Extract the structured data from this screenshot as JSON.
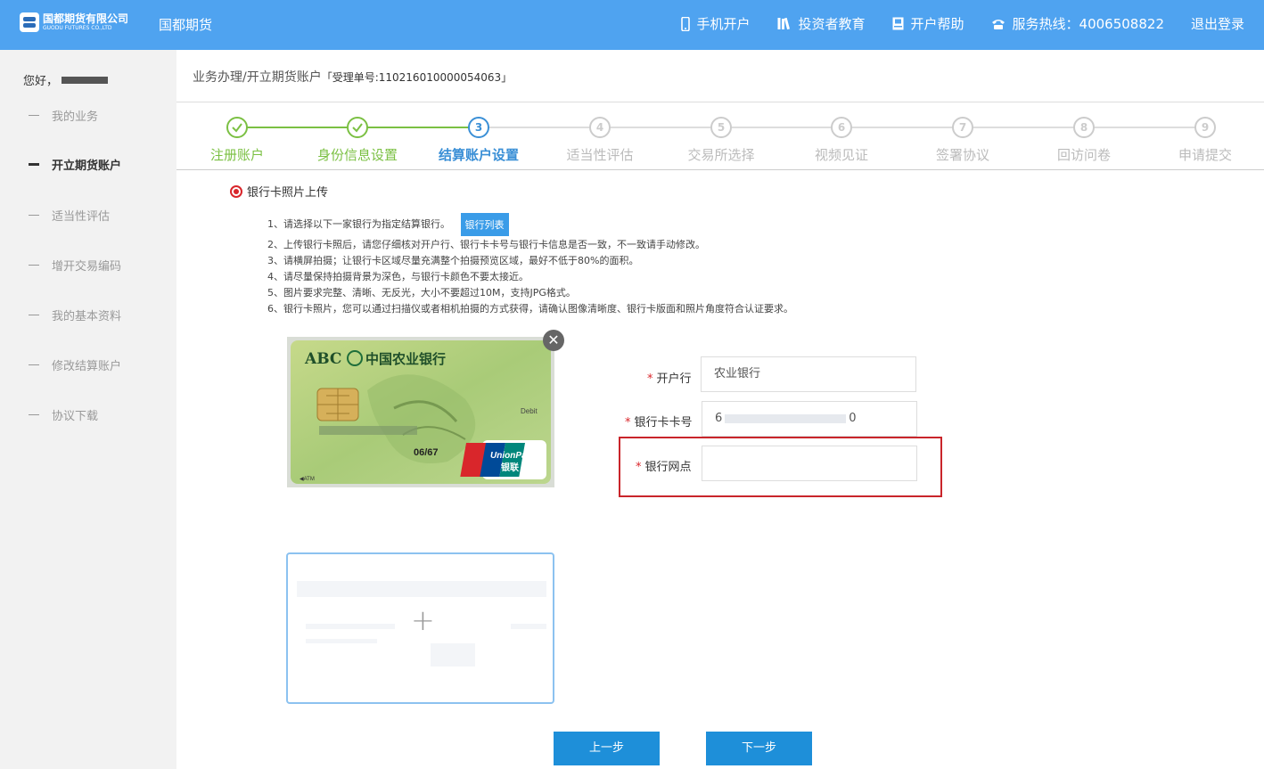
{
  "header": {
    "logo_cn": "国都期货有限公司",
    "logo_en": "GUODU FUTURES CO.,LTD",
    "brand": "国都期货",
    "nav": {
      "mobile_label": "手机开户",
      "edu_label": "投资者教育",
      "help_label": "开户帮助",
      "hotline_label": "服务热线：4006508822",
      "logout_label": "退出登录"
    }
  },
  "sidebar": {
    "greeting": "您好，",
    "items": [
      {
        "label": "我的业务"
      },
      {
        "label": "开立期货账户"
      },
      {
        "label": "适当性评估"
      },
      {
        "label": "增开交易编码"
      },
      {
        "label": "我的基本资料"
      },
      {
        "label": "修改结算账户"
      },
      {
        "label": "协议下载"
      }
    ]
  },
  "breadcrumb": {
    "path": "业务办理/开立期货账户",
    "ticket": "「受理单号:110216010000054063」"
  },
  "steps": [
    {
      "num": "1",
      "label": "注册账户",
      "status": "done"
    },
    {
      "num": "2",
      "label": "身份信息设置",
      "status": "done"
    },
    {
      "num": "3",
      "label": "结算账户设置",
      "status": "current"
    },
    {
      "num": "4",
      "label": "适当性评估",
      "status": "pending"
    },
    {
      "num": "5",
      "label": "交易所选择",
      "status": "pending"
    },
    {
      "num": "6",
      "label": "视频见证",
      "status": "pending"
    },
    {
      "num": "7",
      "label": "签署协议",
      "status": "pending"
    },
    {
      "num": "8",
      "label": "回访问卷",
      "status": "pending"
    },
    {
      "num": "9",
      "label": "申请提交",
      "status": "pending"
    }
  ],
  "upload_section": {
    "title": "银行卡照片上传",
    "instructions": [
      "1、请选择以下一家银行为指定结算银行。",
      "2、上传银行卡照后，请您仔细核对开户行、银行卡卡号与银行卡信息是否一致，不一致请手动修改。",
      "3、请横屏拍摄；让银行卡区域尽量充满整个拍摄预览区域，最好不低于80%的面积。",
      "4、请尽量保持拍摄背景为深色，与银行卡颜色不要太接近。",
      "5、图片要求完整、清晰、无反光，大小不要超过10M，支持JPG格式。",
      "6、银行卡照片，您可以通过扫描仪或者相机拍摄的方式获得，请确认图像清晰度、银行卡版面和照片角度符合认证要求。"
    ],
    "bank_list_button": "银行列表",
    "card": {
      "abc": "ABC",
      "bank_name": "中国农业银行",
      "debit": "Debit",
      "expiry": "06/67",
      "unionpay": "UnionPay",
      "unionpay_cn": "银联",
      "atm": "◀ATM"
    }
  },
  "form": {
    "bank": {
      "label": "开户行",
      "value": "农业银行"
    },
    "card_no": {
      "label": "银行卡卡号",
      "prefix": "6",
      "suffix": "0"
    },
    "branch": {
      "label": "银行网点",
      "value": ""
    }
  },
  "buttons": {
    "prev": "上一步",
    "next": "下一步"
  },
  "colors": {
    "header": "#4fa3f0",
    "done": "#7bc043",
    "current": "#3a8fd6",
    "button": "#1e8fd9",
    "required": "#d9262b"
  }
}
